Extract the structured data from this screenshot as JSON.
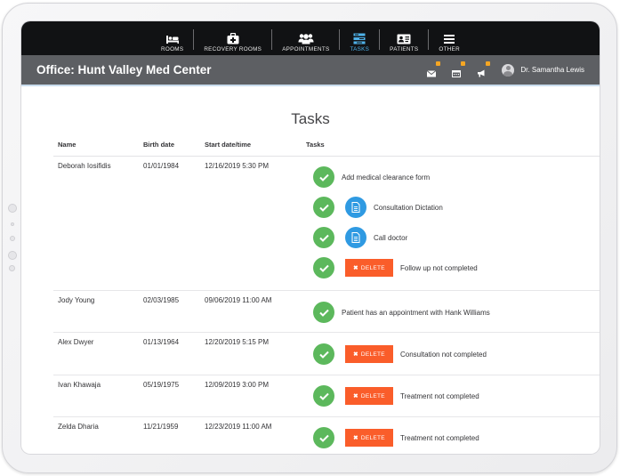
{
  "nav": {
    "items": [
      {
        "label": "ROOMS",
        "icon": "bed-icon",
        "active": false
      },
      {
        "label": "RECOVERY ROOMS",
        "icon": "medkit-icon",
        "active": false
      },
      {
        "label": "APPOINTMENTS",
        "icon": "users-icon",
        "active": false
      },
      {
        "label": "TASKS",
        "icon": "tasks-icon",
        "active": true
      },
      {
        "label": "PATIENTS",
        "icon": "id-card-icon",
        "active": false
      },
      {
        "label": "OTHER",
        "icon": "hamburger-icon",
        "active": false
      }
    ]
  },
  "office": {
    "title": "Office: Hunt Valley Med Center"
  },
  "user": {
    "name": "Dr. Samantha Lewis"
  },
  "page": {
    "title": "Tasks"
  },
  "table": {
    "headers": [
      "Name",
      "Birth date",
      "Start date/time",
      "Tasks"
    ],
    "delete_label": "DELETE",
    "rows": [
      {
        "name": "Deborah Iosifidis",
        "birth": "01/01/1984",
        "start": "12/16/2019 5:30 PM",
        "tasks": [
          {
            "text": "Add medical clearance form",
            "action": "none"
          },
          {
            "text": "Consultation Dictation",
            "action": "document"
          },
          {
            "text": "Call doctor",
            "action": "document"
          },
          {
            "text": "Follow up not completed",
            "action": "delete"
          }
        ]
      },
      {
        "name": "Jody Young",
        "birth": "02/03/1985",
        "start": "09/06/2019 11:00 AM",
        "tasks": [
          {
            "text": "Patient has an appointment with Hank Williams",
            "action": "none"
          }
        ]
      },
      {
        "name": "Alex Dwyer",
        "birth": "01/13/1964",
        "start": "12/20/2019 5:15 PM",
        "tasks": [
          {
            "text": "Consultation not completed",
            "action": "delete"
          }
        ]
      },
      {
        "name": "Ivan Khawaja",
        "birth": "05/19/1975",
        "start": "12/09/2019 3:00 PM",
        "tasks": [
          {
            "text": "Treatment not completed",
            "action": "delete"
          }
        ]
      },
      {
        "name": "Zelda Dharia",
        "birth": "11/21/1959",
        "start": "12/23/2019 11:00 AM",
        "tasks": [
          {
            "text": "Treatment not completed",
            "action": "delete"
          }
        ]
      }
    ]
  },
  "colors": {
    "nav_bg": "#111214",
    "active": "#4fb1e9",
    "office_bar": "#5d5f63",
    "check": "#5cb85c",
    "document": "#2f9ae2",
    "delete": "#fa5d2a",
    "badge": "#f5a623"
  }
}
